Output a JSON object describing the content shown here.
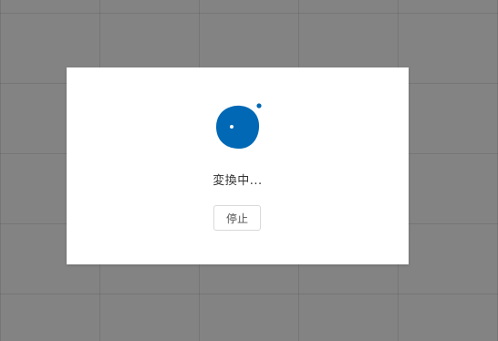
{
  "dialog": {
    "status_text": "変換中...",
    "stop_label": "停止",
    "spinner_icon": "loading-spinner-icon"
  },
  "colors": {
    "accent": "#0068b5",
    "overlay": "#838383"
  }
}
